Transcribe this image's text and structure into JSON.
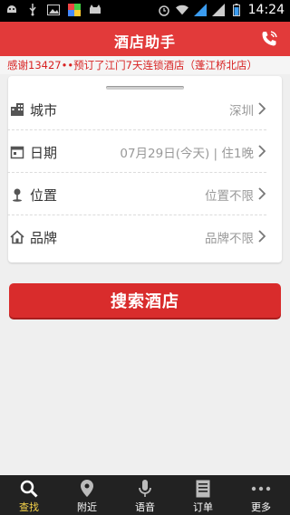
{
  "status_bar": {
    "time": "14:24"
  },
  "header": {
    "title": "酒店助手"
  },
  "notice": {
    "text": "感谢13427••预订了江门7天连锁酒店（蓬江桥北店）"
  },
  "form": {
    "rows": [
      {
        "label": "城市",
        "value": "深圳",
        "icon": "building-icon"
      },
      {
        "label": "日期",
        "value": "07月29日(今天) | 住1晚",
        "icon": "calendar-icon"
      },
      {
        "label": "位置",
        "value": "位置不限",
        "icon": "location-pin-icon"
      },
      {
        "label": "品牌",
        "value": "品牌不限",
        "icon": "home-icon"
      }
    ]
  },
  "search_button": {
    "label": "搜索酒店"
  },
  "tabs": [
    {
      "label": "查找",
      "icon": "search-icon",
      "active": true
    },
    {
      "label": "附近",
      "icon": "location-icon"
    },
    {
      "label": "语音",
      "icon": "microphone-icon"
    },
    {
      "label": "订单",
      "icon": "order-list-icon"
    },
    {
      "label": "更多",
      "icon": "more-dots-icon"
    }
  ],
  "colors": {
    "brand_red": "#e23a3a",
    "active_tab": "#f5d24a"
  }
}
